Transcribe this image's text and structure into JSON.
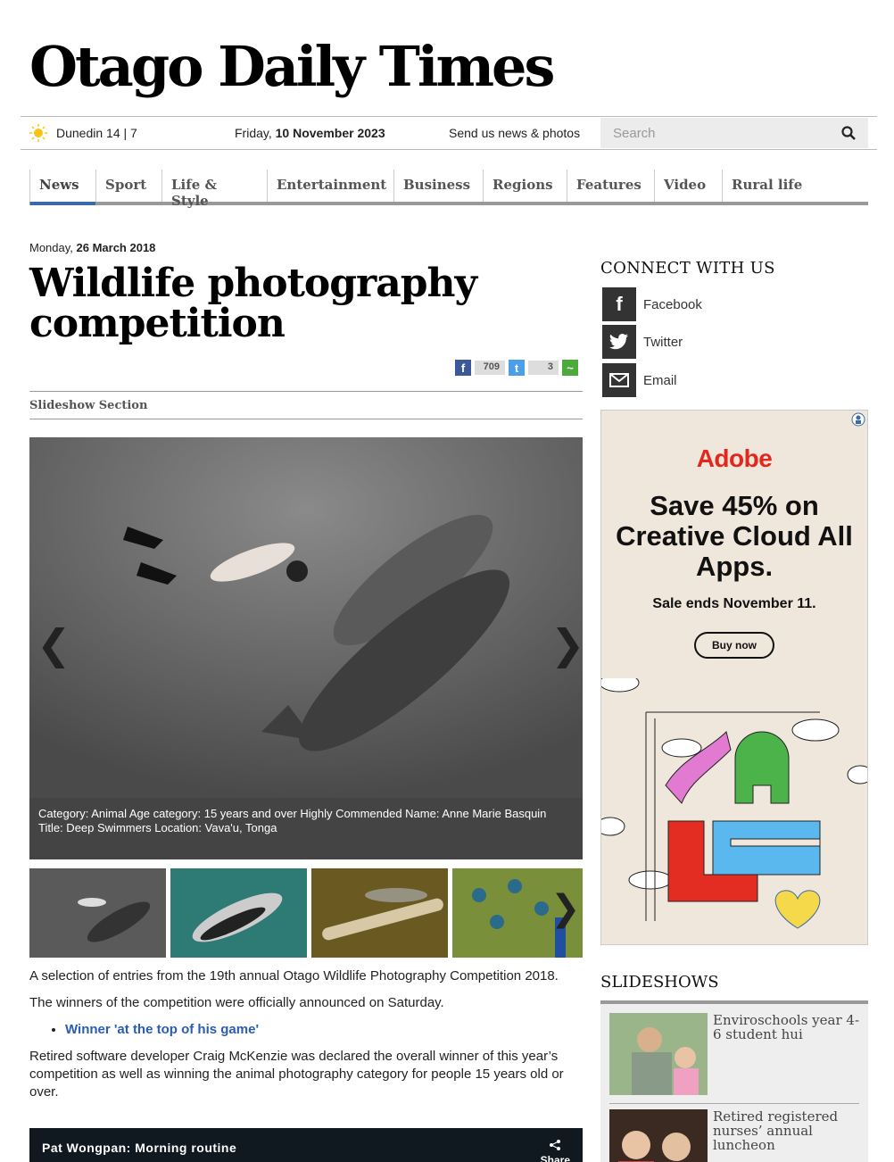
{
  "masthead": {
    "title": "Otago Daily Times"
  },
  "topbar": {
    "weather": "Dunedin 14 | 7",
    "date_prefix": "Friday, ",
    "date_bold": "10 November 2023",
    "send_news": "Send us news & photos",
    "search_placeholder": "Search"
  },
  "nav": {
    "items": [
      "News",
      "Sport",
      "Life & Style",
      "Entertainment",
      "Business",
      "Regions",
      "Features",
      "Video",
      "Rural life"
    ],
    "active": "News"
  },
  "article": {
    "date_prefix": "Monday, ",
    "date_bold": "26 March 2018",
    "title": "Wildlife photography competition",
    "share_fb_count": "709",
    "share_tw_count": "3",
    "section_label": "Slideshow Section",
    "slide_caption": "Category: Animal Age category: 15 years and over Highly Commended Name: Anne Marie Basquin Title: Deep Swimmers Location: Vava'u, Tonga",
    "para1": "A selection of entries from the 19th annual Otago Wildlife Photography Competition 2018.",
    "para2": "The winners of the competition were officially announced on Saturday.",
    "link1": "Winner 'at the top of his game'",
    "para3": "Retired software developer Craig McKenzie was declared the overall winner of this year’s competition as well as winning the animal photography category for people 15 years old or over.",
    "video_title": "Pat Wongpan: Morning routine",
    "video_share": "Share"
  },
  "sidebar": {
    "connect_title": "CONNECT WITH US",
    "social": [
      {
        "label": "Facebook",
        "icon": "facebook-icon"
      },
      {
        "label": "Twitter",
        "icon": "twitter-icon"
      },
      {
        "label": "Email",
        "icon": "email-icon"
      }
    ],
    "ad": {
      "brand": "Adobe",
      "headline": "Save 45% on Creative Cloud All Apps.",
      "sub": "Sale ends November 11.",
      "cta": "Buy now"
    },
    "slideshows_title": "SLIDESHOWS",
    "slideshows": [
      {
        "title": "Enviroschools year 4-6 student hui"
      },
      {
        "title": "Retired registered nurses’ annual luncheon"
      }
    ]
  },
  "colors": {
    "accent": "#3a6aa8",
    "link": "#2a5db0",
    "adobe_red": "#e3271b"
  }
}
